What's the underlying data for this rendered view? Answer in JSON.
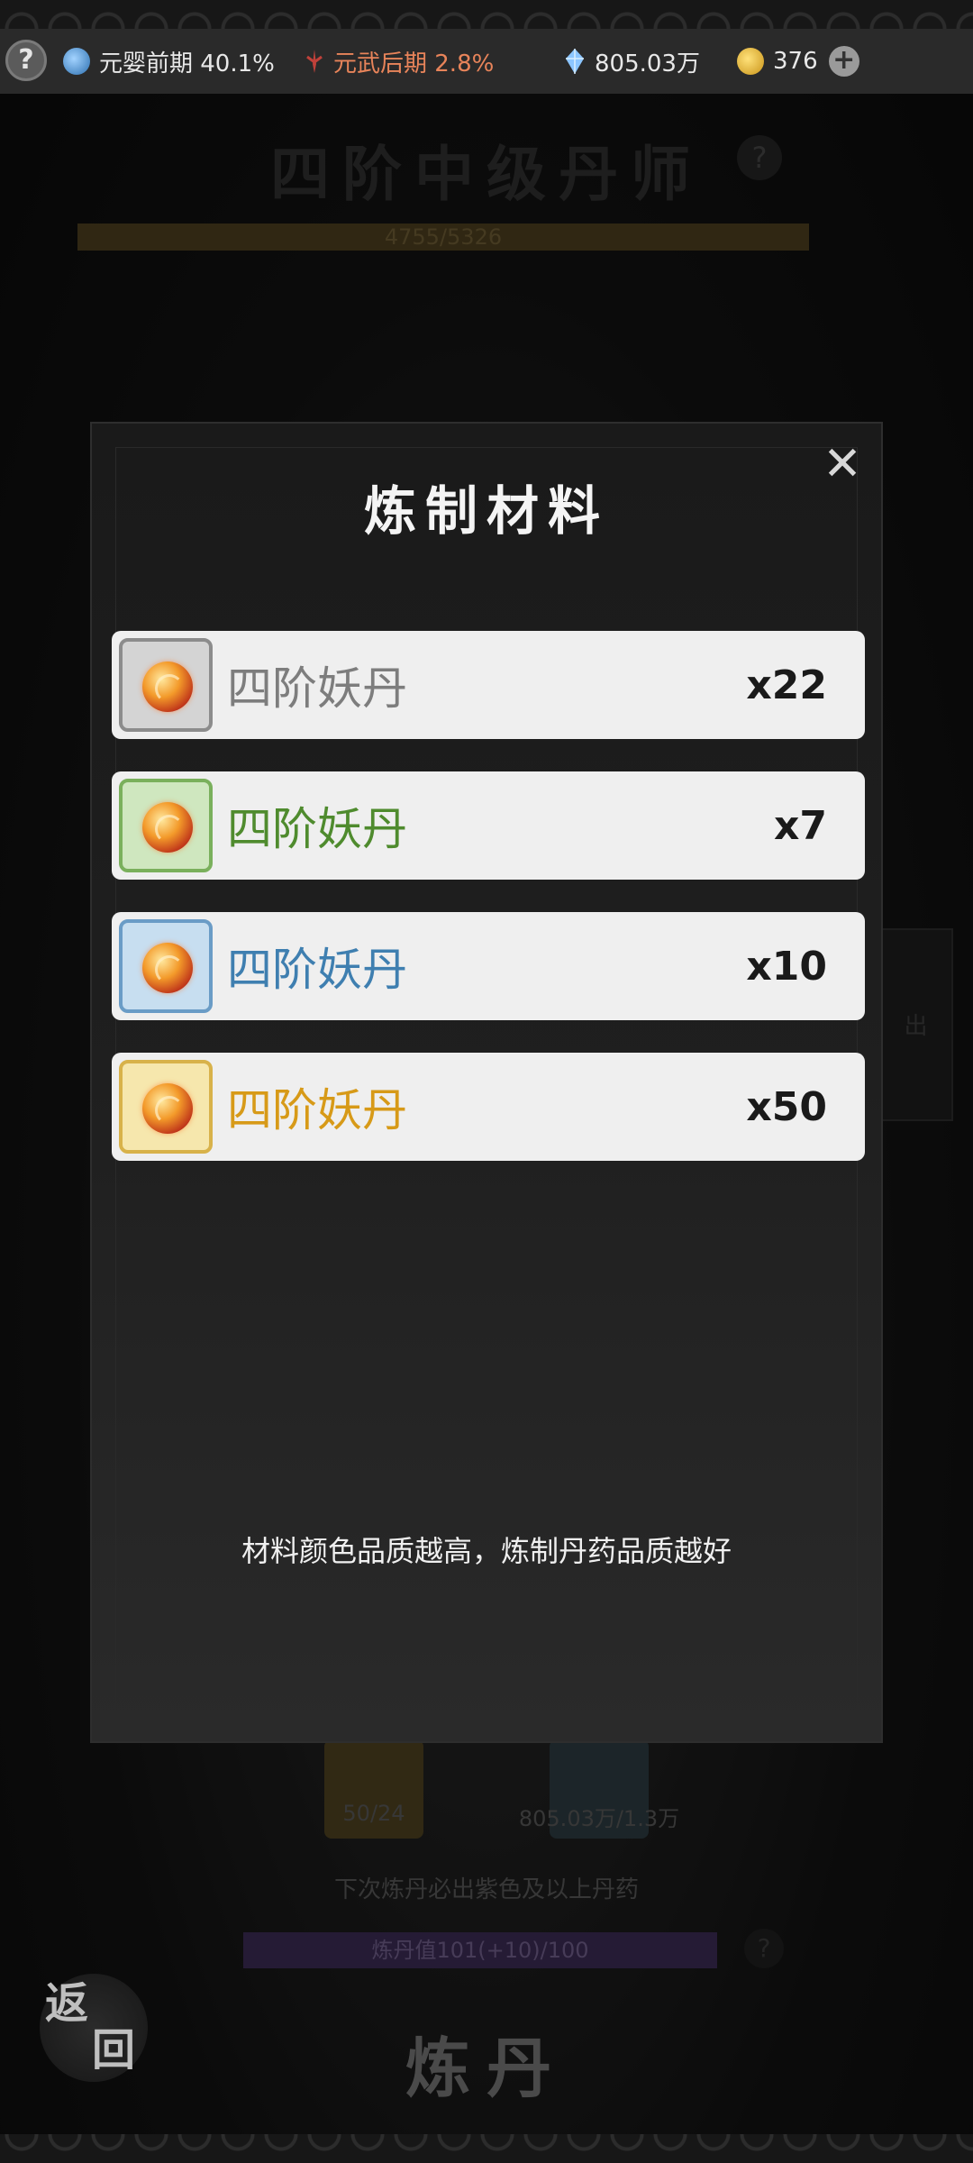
{
  "status_bar": {
    "help_label": "?",
    "realm1": {
      "icon": "yin-yang-icon",
      "text": "元婴前期 40.1%",
      "color": "#e8e8e8"
    },
    "realm2": {
      "icon": "sword-icon",
      "text": "元武后期 2.8%",
      "color": "#e8845a"
    },
    "spirit_stones": {
      "icon": "crystal-icon",
      "text": "805.03万"
    },
    "gold": {
      "icon": "coin-icon",
      "text": "376"
    },
    "plus_label": "+"
  },
  "background": {
    "title": "四阶中级丹师",
    "progress_text": "4755/5326",
    "side_tab": "出",
    "cost1": "50/24",
    "cost2": "805.03万/1.3万",
    "next_note": "下次炼丹必出紫色及以上丹药",
    "pill_value": "炼丹值101(+10)/100",
    "back_label_1": "返",
    "back_label_2": "回",
    "craft_label": "炼丹"
  },
  "modal": {
    "title": "炼制材料",
    "close_label": "✕",
    "items": [
      {
        "name": "四阶妖丹",
        "count": "x22",
        "quality": "white",
        "name_color": "#7d7d7d",
        "bg": "#d4d4d4",
        "border": "#8c8c8c"
      },
      {
        "name": "四阶妖丹",
        "count": "x7",
        "quality": "green",
        "name_color": "#4f8b2e",
        "bg": "#cfe7bf",
        "border": "#7ab05c"
      },
      {
        "name": "四阶妖丹",
        "count": "x10",
        "quality": "blue",
        "name_color": "#3f7fb0",
        "bg": "#c7def0",
        "border": "#6a9cc6"
      },
      {
        "name": "四阶妖丹",
        "count": "x50",
        "quality": "gold",
        "name_color": "#d79a18",
        "bg": "#f6e7ad",
        "border": "#d8b24a"
      }
    ],
    "tip": "材料颜色品质越高，炼制丹药品质越好"
  }
}
